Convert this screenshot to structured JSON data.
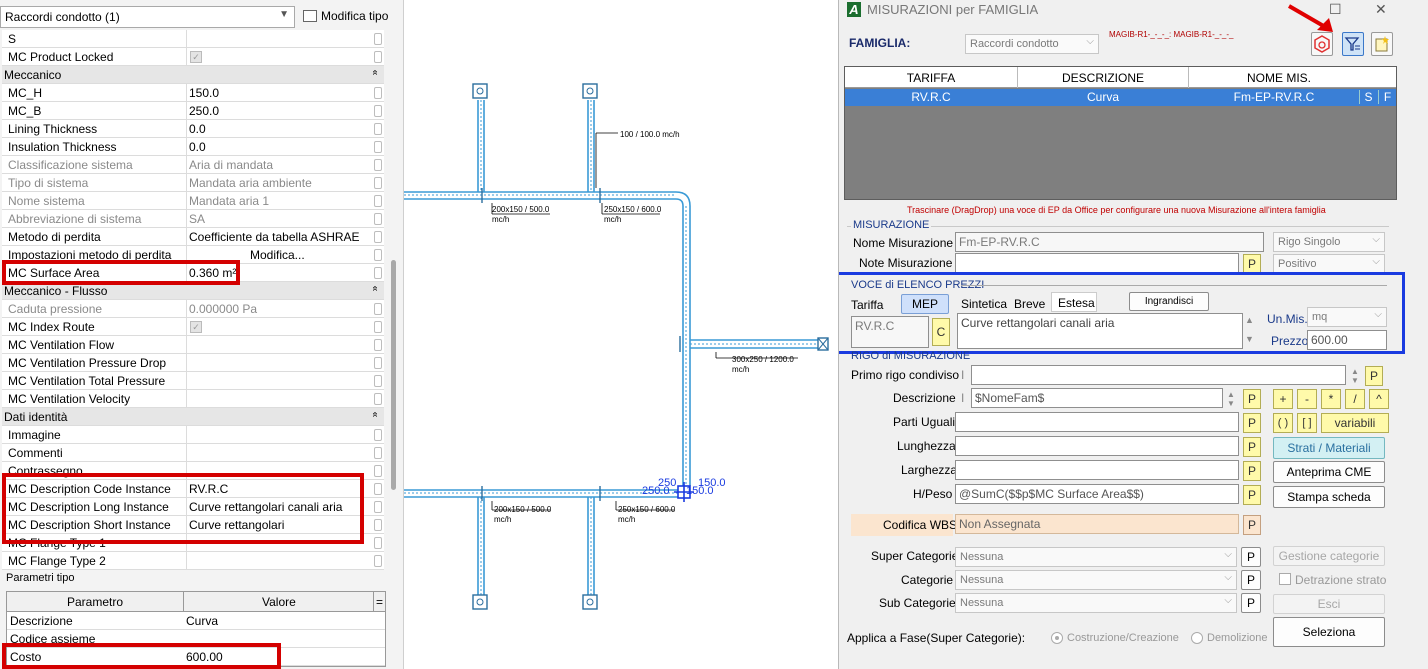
{
  "left": {
    "combo_value": "Raccordi condotto (1)",
    "edit_type_label": "Modifica tipo",
    "rows": [
      {
        "k": "S",
        "v": "",
        "type": "row"
      },
      {
        "k": "MC Product Locked",
        "v": "",
        "type": "check"
      },
      {
        "k": "Meccanico",
        "v": "",
        "type": "group"
      },
      {
        "k": "MC_H",
        "v": "150.0",
        "type": "row"
      },
      {
        "k": "MC_B",
        "v": "250.0",
        "type": "row"
      },
      {
        "k": "Lining Thickness",
        "v": "0.0",
        "type": "row"
      },
      {
        "k": "Insulation Thickness",
        "v": "0.0",
        "type": "row"
      },
      {
        "k": "Classificazione sistema",
        "v": "Aria di mandata",
        "type": "dis"
      },
      {
        "k": "Tipo di sistema",
        "v": "Mandata aria ambiente",
        "type": "dis"
      },
      {
        "k": "Nome sistema",
        "v": "Mandata aria 1",
        "type": "dis"
      },
      {
        "k": "Abbreviazione di sistema",
        "v": "SA",
        "type": "dis"
      },
      {
        "k": "Metodo di perdita",
        "v": "Coefficiente da tabella ASHRAE",
        "type": "row"
      },
      {
        "k": "Impostazioni metodo di perdita",
        "v": "Modifica...",
        "type": "row"
      },
      {
        "k": "MC Surface Area",
        "v": "0.360 m²",
        "type": "row"
      },
      {
        "k": "Meccanico - Flusso",
        "v": "",
        "type": "group"
      },
      {
        "k": "Caduta pressione",
        "v": "0.000000 Pa",
        "type": "dis"
      },
      {
        "k": "MC Index Route",
        "v": "",
        "type": "check"
      },
      {
        "k": "MC Ventilation Flow",
        "v": "",
        "type": "row"
      },
      {
        "k": "MC Ventilation Pressure Drop",
        "v": "",
        "type": "row"
      },
      {
        "k": "MC Ventilation Total Pressure",
        "v": "",
        "type": "row"
      },
      {
        "k": "MC Ventilation Velocity",
        "v": "",
        "type": "row"
      },
      {
        "k": "Dati identità",
        "v": "",
        "type": "group"
      },
      {
        "k": "Immagine",
        "v": "",
        "type": "row"
      },
      {
        "k": "Commenti",
        "v": "",
        "type": "row"
      },
      {
        "k": "Contrassegno",
        "v": "",
        "type": "row"
      },
      {
        "k": "MC Description Code Instance",
        "v": "RV.R.C",
        "type": "row"
      },
      {
        "k": "MC Description Long Instance",
        "v": "Curve rettangolari canali aria",
        "type": "row"
      },
      {
        "k": "MC Description Short Instance",
        "v": "Curve rettangolari",
        "type": "row"
      },
      {
        "k": "MC Flange Type 1",
        "v": "",
        "type": "row"
      },
      {
        "k": "MC Flange Type 2",
        "v": "",
        "type": "row"
      }
    ],
    "type_params_label": "Parametri tipo",
    "type_table": {
      "headers": [
        "Parametro",
        "Valore",
        "="
      ],
      "rows": [
        {
          "k": "Descrizione",
          "v": "Curva"
        },
        {
          "k": "Codice assieme",
          "v": ""
        },
        {
          "k": "Costo",
          "v": "600.00"
        }
      ]
    }
  },
  "drawing": {
    "labels": [
      "100 / 100.0 mc/h",
      "200x150 / 500.0",
      "mc/h",
      "250x150 / 600.0",
      "mc/h",
      "300x250 / 1200.0",
      "mc/h",
      "200x150 / 500.0",
      "mc/h",
      "250x150 / 600.0",
      "mc/h",
      "250",
      "150.0",
      "250.0",
      "150.0"
    ]
  },
  "dialog": {
    "title": "MISURAZIONI per FAMIGLIA",
    "famiglia_label": "FAMIGLIA:",
    "famiglia_value": "Raccordi condotto",
    "magib_text": "MAGIB-R1-_-_-_: MAGIB-R1-_-_-_",
    "grid_headers": [
      "TARIFFA",
      "DESCRIZIONE",
      "NOME MIS."
    ],
    "grid_row": {
      "tariffa": "RV.R.C",
      "descrizione": "Curva",
      "nome": "Fm-EP-RV.R.C",
      "s": "S",
      "f": "F"
    },
    "hint": "Trascinare (DragDrop) una voce di EP da Office per configurare una nuova Misurazione all'intera famiglia",
    "misurazione": {
      "title": "MISURAZIONE",
      "nome_label": "Nome Misurazione",
      "nome_value": "Fm-EP-RV.R.C",
      "note_label": "Note Misurazione",
      "note_value": "",
      "rigo_singolo": "Rigo Singolo",
      "positivo": "Positivo"
    },
    "voce": {
      "title": "VOCE di ELENCO PREZZI",
      "tariffa_label": "Tariffa",
      "mep_label": "MEP",
      "tabs": [
        "Sintetica",
        "Breve",
        "Estesa"
      ],
      "ingrandisci": "Ingrandisci",
      "code": "RV.R.C",
      "c_label": "C",
      "desc": "Curve rettangolari canali aria",
      "unmis_label": "Un.Mis.",
      "unmis_value": "mq",
      "prezzo_label": "Prezzo",
      "prezzo_value": "600.00"
    },
    "rigo": {
      "title": "RIGO di MISURAZIONE",
      "primo_label": "Primo rigo condiviso",
      "descrizione_label": "Descrizione",
      "descrizione_value": "$NomeFam$",
      "parti_label": "Parti Uguali",
      "lunghezza_label": "Lunghezza",
      "larghezza_label": "Larghezza",
      "hpeso_label": "H/Peso",
      "hpeso_value": "@SumC($$p$MC Surface Area$$)",
      "cursor_i": "I",
      "p": "P"
    },
    "ops": [
      "+",
      "-",
      "*",
      "/",
      "^",
      "( )",
      "[ ]"
    ],
    "variabili": "variabili",
    "strati": "Strati / Materiali",
    "anteprima": "Anteprima CME",
    "stampa": "Stampa scheda",
    "wbs_label": "Codifica WBS",
    "wbs_value": "Non Assegnata",
    "super_label": "Super Categorie",
    "super_value": "Nessuna",
    "cat_label": "Categorie",
    "cat_value": "Nessuna",
    "sub_label": "Sub Categorie",
    "sub_value": "Nessuna",
    "gestione": "Gestione categorie",
    "detrazione": "Detrazione strato",
    "esci": "Esci",
    "fase_label": "Applica a Fase(Super Categorie):",
    "costruzione": "Costruzione/Creazione",
    "demolizione": "Demolizione",
    "seleziona": "Seleziona",
    "colors": {
      "blue_frame": "#1a3be0",
      "red_frame": "#d40000",
      "selection": "#3a7fd6",
      "yellow": "#fffaaa"
    }
  }
}
